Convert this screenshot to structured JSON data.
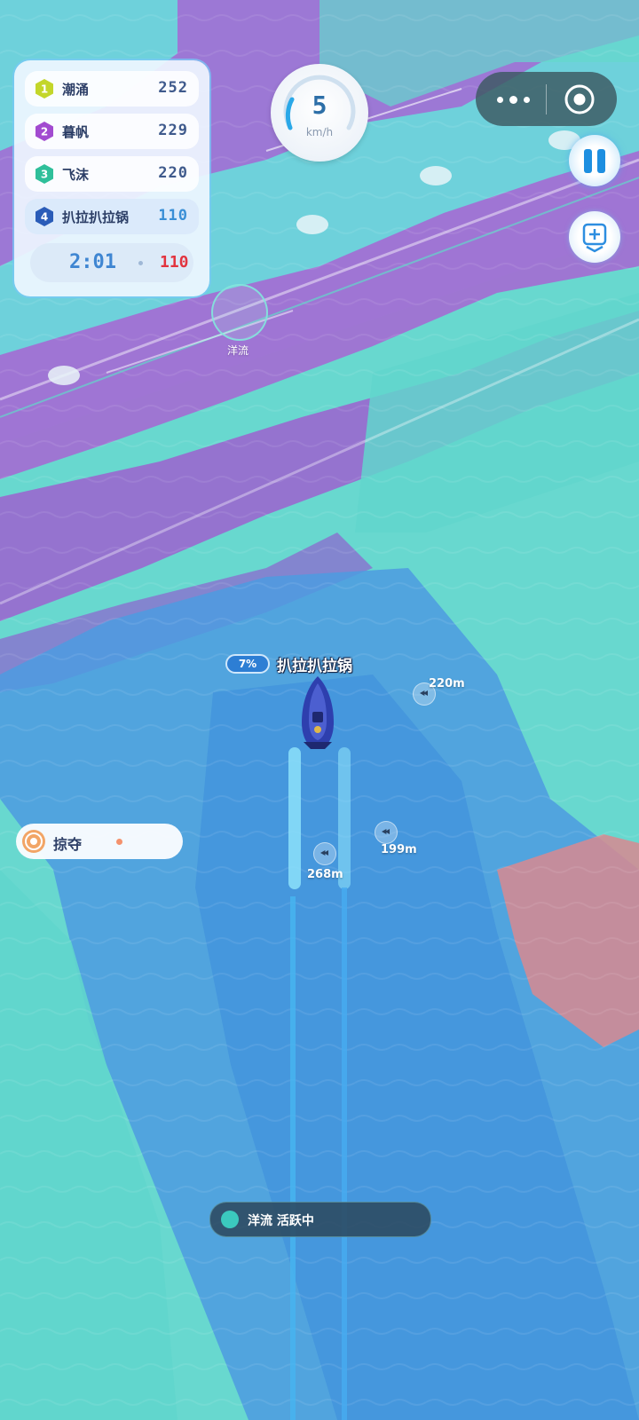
{
  "leaderboard": {
    "entries": [
      {
        "rank": "1",
        "name": "潮涌",
        "score": "252",
        "color": "#c3d62a"
      },
      {
        "rank": "2",
        "name": "暮帆",
        "score": "229",
        "color": "#a24bd0"
      },
      {
        "rank": "3",
        "name": "飞沫",
        "score": "220",
        "color": "#2fbf9a"
      },
      {
        "rank": "4",
        "name": "扒拉扒拉锅",
        "score": "110",
        "color": "#2a5cb8"
      }
    ],
    "timer": "2:01",
    "my_score": "110"
  },
  "speedometer": {
    "value": "5",
    "unit": "km/h"
  },
  "capsule": {
    "more_icon": "more-dots-icon",
    "close_icon": "target-circle-icon"
  },
  "controls": {
    "pause_icon": "pause-icon",
    "report_icon": "report-plus-icon"
  },
  "ocean_current": {
    "label": "洋流"
  },
  "player": {
    "progress": "7%",
    "name": "扒拉扒拉锅"
  },
  "distances": {
    "d1": "220m",
    "d2": "199m",
    "d3": "268m"
  },
  "plunder": {
    "label": "掠夺"
  },
  "status": {
    "text": "洋流 活跃中"
  },
  "colors": {
    "teal": "#66d9d0",
    "purple": "#a565d3",
    "blue": "#4f9be0",
    "red_zone": "#d98088",
    "danger_red": "#e2343f"
  }
}
